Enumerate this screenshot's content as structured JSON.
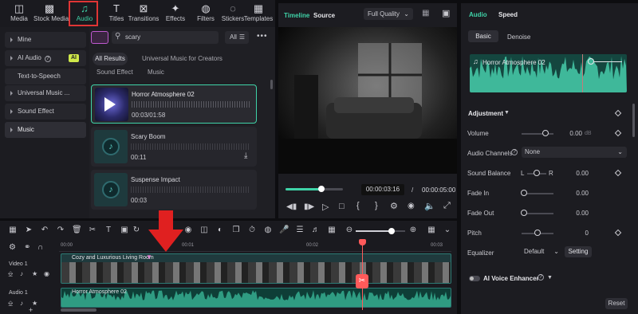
{
  "toolbar": {
    "items": [
      {
        "label": "Media",
        "icon": "media-icon"
      },
      {
        "label": "Stock Media",
        "icon": "stock-media-icon"
      },
      {
        "label": "Audio",
        "icon": "audio-note-icon",
        "active": true
      },
      {
        "label": "Titles",
        "icon": "titles-icon"
      },
      {
        "label": "Transitions",
        "icon": "transitions-icon"
      },
      {
        "label": "Effects",
        "icon": "effects-icon"
      },
      {
        "label": "Filters",
        "icon": "filters-icon"
      },
      {
        "label": "Stickers",
        "icon": "stickers-icon"
      },
      {
        "label": "Templates",
        "icon": "templates-icon"
      }
    ],
    "highlight_color": "#e03535",
    "accent_color": "#3fd3a8"
  },
  "sidebar": {
    "items": [
      {
        "label": "Mine"
      },
      {
        "label": "AI Audio",
        "badge": "AI"
      },
      {
        "label": "Text-to-Speech"
      },
      {
        "label": "Universal Music ..."
      },
      {
        "label": "Sound Effect"
      },
      {
        "label": "Music"
      }
    ]
  },
  "search": {
    "value": "scary",
    "filter_label": "All"
  },
  "filter_tabs": {
    "all_results": "All Results",
    "universal": "Universal Music for Creators",
    "sound_effect": "Sound Effect",
    "music": "Music"
  },
  "results": [
    {
      "title": "Horror Atmosphere 02",
      "time": "00:03/01:58"
    },
    {
      "title": "Scary Boom",
      "time": "00:11"
    },
    {
      "title": "Suspense Impact",
      "time": "00:03"
    }
  ],
  "player": {
    "timeline_tab": "Timeline",
    "source_tab": "Source",
    "quality": "Full Quality",
    "current_time": "00:00:03:16",
    "separator": "/",
    "total_time": "00:00:05:00",
    "progress": 0.62
  },
  "right_panel": {
    "tabs": {
      "audio": "Audio",
      "speed": "Speed"
    },
    "subtabs": {
      "basic": "Basic",
      "denoise": "Denoise"
    },
    "clip_title": "Horror Atmosphere 02",
    "adjustment": "Adjustment",
    "volume": {
      "label": "Volume",
      "value": "0.00",
      "unit": "dB"
    },
    "channels": {
      "label": "Audio Channels",
      "value": "None"
    },
    "balance": {
      "label": "Sound Balance",
      "l": "L",
      "r": "R",
      "value": "0.00"
    },
    "fade_in": {
      "label": "Fade In",
      "value": "0.00"
    },
    "fade_out": {
      "label": "Fade Out",
      "value": "0.00"
    },
    "pitch": {
      "label": "Pitch",
      "value": "0"
    },
    "equalizer": {
      "label": "Equalizer",
      "value": "Default",
      "setting": "Setting"
    },
    "ai_voice": "AI Voice Enhancer",
    "reset": "Reset"
  },
  "timeline": {
    "ruler": [
      "00:00",
      "00:01",
      "00:02",
      "00:03",
      "00:04"
    ],
    "video_track_label": "Video 1",
    "audio_track_label": "Audio 1",
    "video_clip": "Cozy and Luxurious Living Room",
    "audio_clip": "Horror Atmosphere 02"
  }
}
